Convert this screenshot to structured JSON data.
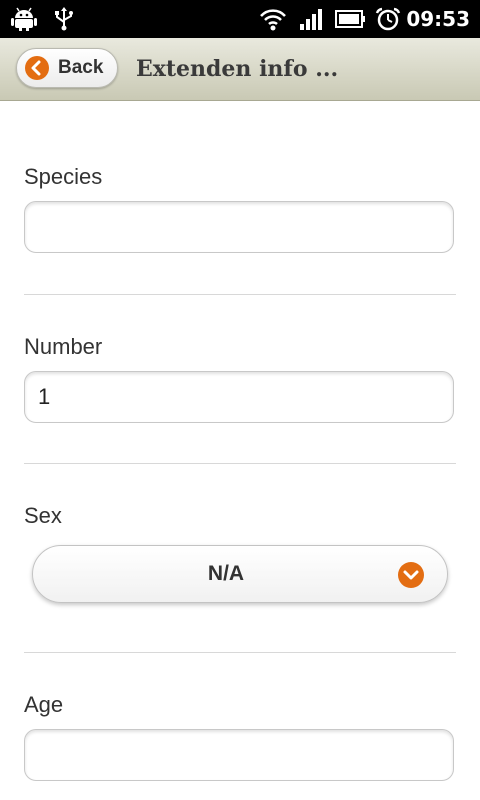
{
  "status_bar": {
    "time": "09:53",
    "icons": [
      "android-debug-icon",
      "usb-icon",
      "wifi-icon",
      "signal-icon",
      "battery-icon",
      "alarm-icon"
    ]
  },
  "header": {
    "back_label": "Back",
    "title": "Extenden info ..."
  },
  "form": {
    "species": {
      "label": "Species",
      "value": "",
      "placeholder": ""
    },
    "number": {
      "label": "Number",
      "value": "1"
    },
    "sex": {
      "label": "Sex",
      "selected": "N/A"
    },
    "age": {
      "label": "Age",
      "value": "",
      "placeholder": ""
    }
  },
  "colors": {
    "accent": "#e36d12",
    "header_top": "#e9e9de",
    "header_bottom": "#c9c9b4",
    "status_bar": "#000000"
  }
}
